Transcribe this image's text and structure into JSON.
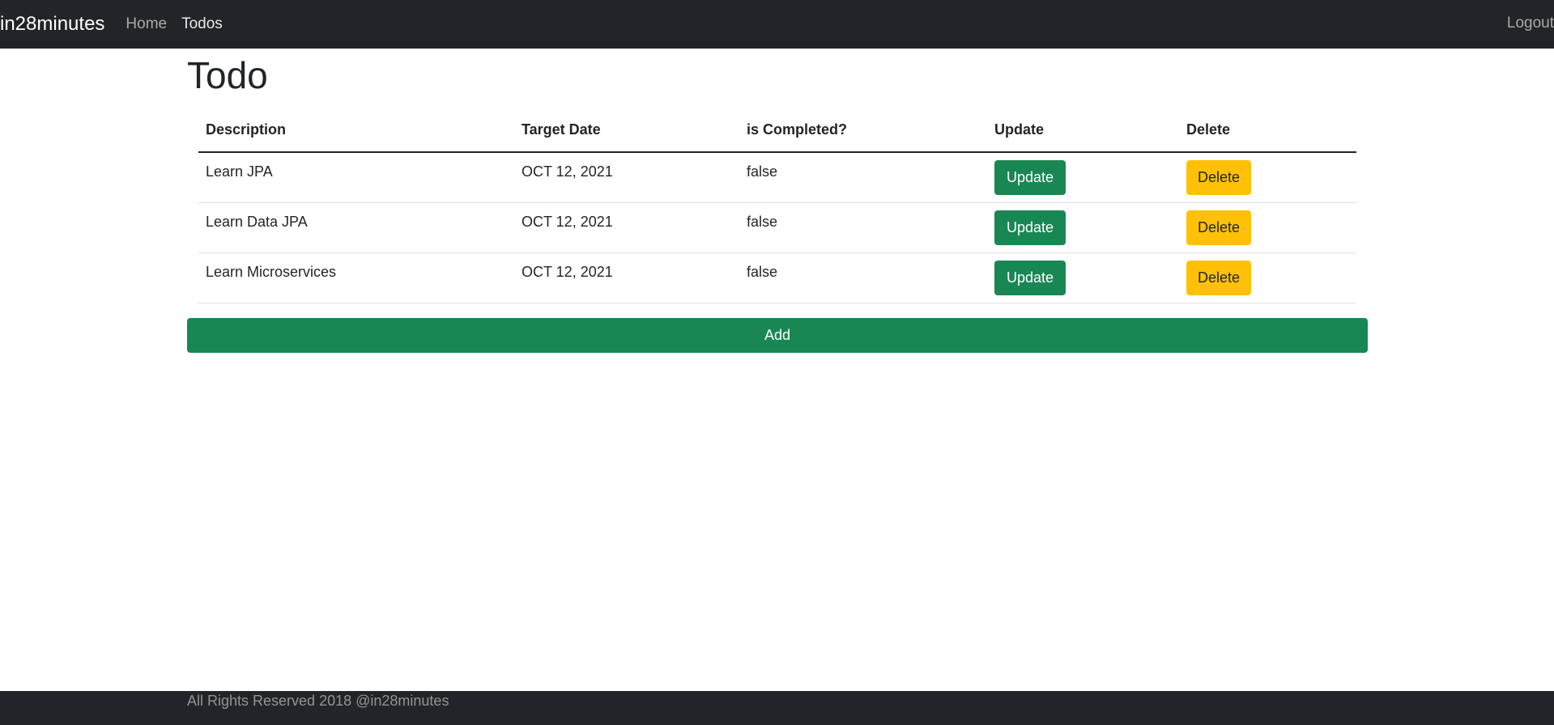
{
  "navbar": {
    "brand": "in28minutes",
    "links": [
      {
        "label": "Home"
      },
      {
        "label": "Todos"
      }
    ],
    "logout": "Logout"
  },
  "page": {
    "title": "Todo"
  },
  "table": {
    "headers": [
      "Description",
      "Target Date",
      "is Completed?",
      "Update",
      "Delete"
    ],
    "rows": [
      {
        "description": "Learn JPA",
        "target_date": "OCT 12, 2021",
        "completed": "false",
        "update_label": "Update",
        "delete_label": "Delete"
      },
      {
        "description": "Learn Data JPA",
        "target_date": "OCT 12, 2021",
        "completed": "false",
        "update_label": "Update",
        "delete_label": "Delete"
      },
      {
        "description": "Learn Microservices",
        "target_date": "OCT 12, 2021",
        "completed": "false",
        "update_label": "Update",
        "delete_label": "Delete"
      }
    ]
  },
  "add_button": "Add",
  "footer": {
    "text": "All Rights Reserved 2018 @in28minutes"
  },
  "colors": {
    "navbar": "#212529",
    "success": "#198754",
    "warning": "#ffc107"
  }
}
